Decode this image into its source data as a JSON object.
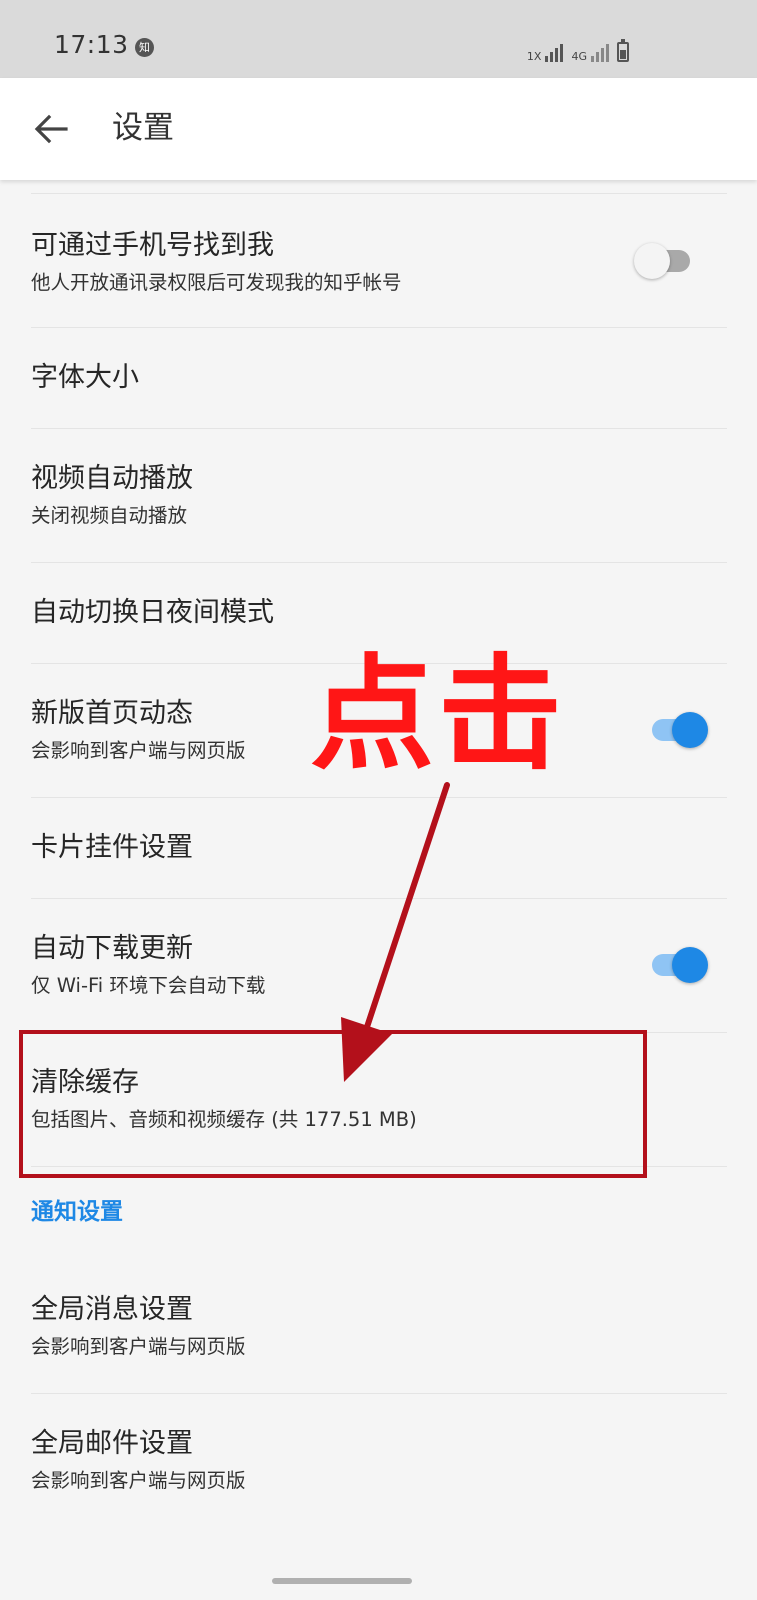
{
  "status_bar": {
    "time": "17:13",
    "app_badge": "知",
    "network_badge_1": "1X",
    "network_badge_2": "4G"
  },
  "app_bar": {
    "title": "设置"
  },
  "settings": [
    {
      "title": "可通过手机号找到我",
      "subtitle": "他人开放通讯录权限后可发现我的知乎帐号",
      "toggle": "off"
    },
    {
      "title": "字体大小"
    },
    {
      "title": "视频自动播放",
      "subtitle": "关闭视频自动播放"
    },
    {
      "title": "自动切换日夜间模式"
    },
    {
      "title": "新版首页动态",
      "subtitle": "会影响到客户端与网页版",
      "toggle": "on"
    },
    {
      "title": "卡片挂件设置"
    },
    {
      "title": "自动下载更新",
      "subtitle": "仅 Wi-Fi 环境下会自动下载",
      "toggle": "on"
    },
    {
      "title": "清除缓存",
      "subtitle": "包括图片、音频和视频缓存 (共 177.51 MB)"
    }
  ],
  "section_header": "通知设置",
  "notification_settings": [
    {
      "title": "全局消息设置",
      "subtitle": "会影响到客户端与网页版"
    },
    {
      "title": "全局邮件设置",
      "subtitle": "会影响到客户端与网页版"
    }
  ],
  "annotation": {
    "text": "点击",
    "color": "#ff1616"
  },
  "colors": {
    "accent": "#1e88e5",
    "highlight_box": "#b3101b",
    "background": "#f5f5f5"
  }
}
